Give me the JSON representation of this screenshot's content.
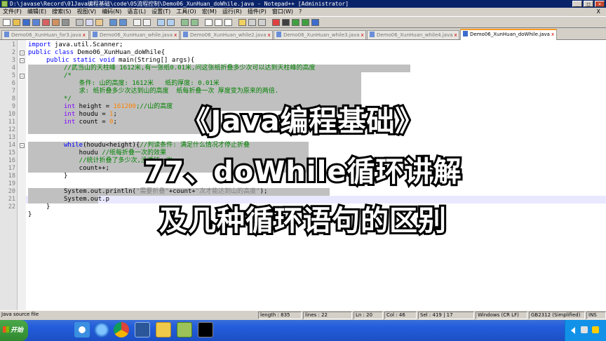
{
  "window": {
    "title": "D:\\javase\\Record\\01Java编程基础\\code\\05流程控制\\Demo06_XunHuan_doWhile.java - Notepad++ [Administrator]",
    "min_label": "_",
    "max_label": "□",
    "close_label": "×"
  },
  "menu": [
    "文件(F)",
    "编辑(E)",
    "搜索(S)",
    "视图(V)",
    "编码(N)",
    "语言(L)",
    "设置(T)",
    "工具(O)",
    "宏(M)",
    "运行(R)",
    "插件(P)",
    "窗口(W)",
    "?"
  ],
  "menu_close": "X",
  "tabs": [
    {
      "label": "Demo06_XunHuan_for3.java",
      "active": false
    },
    {
      "label": "Demo06_XunHuan_while.java",
      "active": false
    },
    {
      "label": "Demo06_XunHuan_while2.java",
      "active": false
    },
    {
      "label": "Demo06_XunHuan_while3.java",
      "active": false
    },
    {
      "label": "Demo06_XunHuan_while4.java",
      "active": false
    },
    {
      "label": "Demo06_XunHuan_doWhile.java",
      "active": true
    }
  ],
  "tab_close": "x",
  "line_numbers": [
    "1",
    "2",
    "3",
    "4",
    "5",
    "6",
    "7",
    "8",
    "9",
    "10",
    "11",
    "12",
    "13",
    "14",
    "15",
    "16",
    "17",
    "18",
    "19",
    "20",
    "21",
    "22"
  ],
  "code": {
    "l1_kw": "import",
    "l1_rest": " java.util.Scanner;",
    "l2_kw": "public class",
    "l2_rest": " Demo06_XunHuan_doWhile{",
    "l3_kw": "public static void",
    "l3_rest": " main(String[] args){",
    "l4": "//武当山的天柱峰 1612米,有一张纸0.01米,问这张纸折叠多少次可以达到天柱峰的高度",
    "l5": "/*",
    "l6": "    条件: 山的高度: 1612米   纸的厚度: 0.01米",
    "l7": "    求: 纸折叠多少次达到山的高度  纸每折叠一次 厚度变为原来的两倍.",
    "l8": "*/",
    "l9_kw": "int",
    "l9_rest": " height = ",
    "l9_num": "161200",
    "l9_cm": ";//山的高度",
    "l10_kw": "int",
    "l10_rest": " houdu = ",
    "l10_num": "1",
    "l10_end": ";",
    "l11_kw": "int",
    "l11_rest": " count = ",
    "l11_num": "0",
    "l11_end": ";",
    "l13_kw": "while",
    "l13_rest": "(houdu<height){",
    "l13_cm": "//判读条件: 满足什么情况才停止折叠",
    "l14": "    houdu ",
    "l14_cm": "//纸每折叠一次的效果",
    "l15_cm": "    //统计折叠了多少次,没循环一次",
    "l16": "    count++;",
    "l17": "}",
    "l19_a": "System.out.println(",
    "l19_s1": "\"需要折叠\"",
    "l19_b": "+count+",
    "l19_s2": "\"次才能达到山的高度\"",
    "l19_c": ");",
    "l20": "System.out.p",
    "l21": "}",
    "l22": "}"
  },
  "overlay": {
    "line1": "《Java编程基础》",
    "line2": "77、doWhile循环讲解",
    "line3": "及几种循环语句的区别"
  },
  "status": {
    "file_type": "Java source file",
    "length": "length : 835",
    "lines": "lines : 22",
    "ln": "Ln : 20",
    "col": "Col : 46",
    "sel": "Sel : 419 | 17",
    "eol": "Windows (CR LF)",
    "encoding": "GB2312 (Simplified)",
    "mode": "INS"
  },
  "taskbar": {
    "start_label": "开始"
  },
  "colors": {
    "keyword": "#0000ff",
    "type": "#8000ff",
    "comment": "#008000",
    "number": "#ff8000",
    "selection": "#c0c0c0",
    "active_tab_accent": "#f59c25"
  }
}
